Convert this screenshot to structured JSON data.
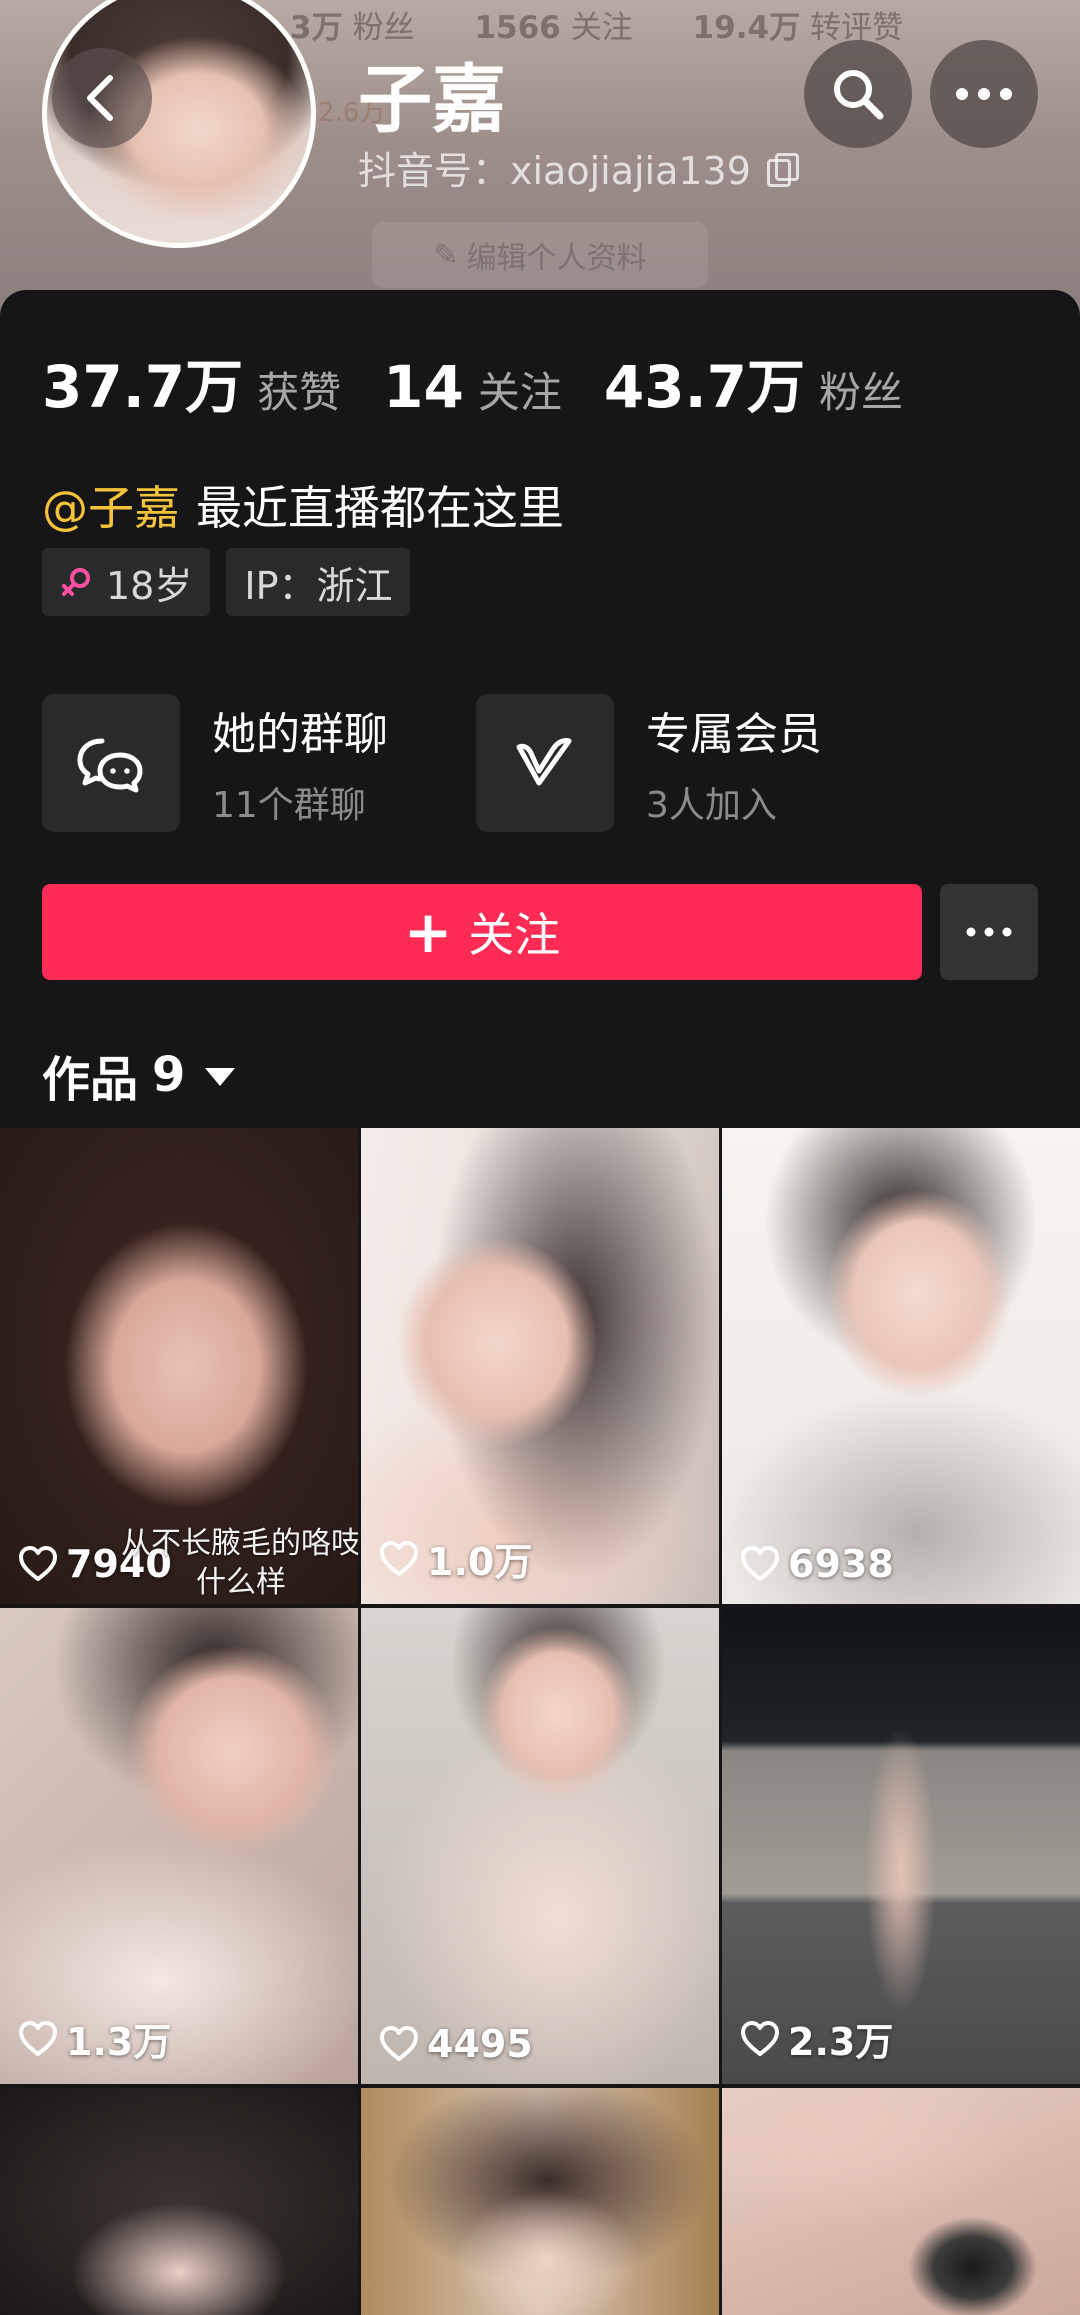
{
  "header_bg": {
    "ghost_stats": [
      {
        "num": "3万",
        "label": "粉丝"
      },
      {
        "num": "1566",
        "label": "关注"
      },
      {
        "num": "19.4万",
        "label": "转评赞"
      }
    ],
    "ghost_small": "2.6万",
    "ghost_edit": "编辑个人资料"
  },
  "profile": {
    "name": "子嘉",
    "douyin_id": "抖音号：xiaojiajia139"
  },
  "stats": [
    {
      "num": "37.7万",
      "label": "获赞"
    },
    {
      "num": "14",
      "label": "关注"
    },
    {
      "num": "43.7万",
      "label": "粉丝"
    }
  ],
  "bio": {
    "mention": "@子嘉",
    "text": "最近直播都在这里"
  },
  "tags": [
    {
      "icon": "female-icon",
      "text": "18岁"
    },
    {
      "text": "IP：浙江"
    }
  ],
  "features": [
    {
      "icon": "group-chat-icon",
      "title": "她的群聊",
      "sub": "11个群聊"
    },
    {
      "icon": "vip-v-icon",
      "title": "专属会员",
      "sub": "3人加入"
    }
  ],
  "follow": {
    "plus": "+",
    "label": "关注"
  },
  "works": {
    "label": "作品",
    "count": "9"
  },
  "tiles": [
    {
      "likes": "7940",
      "caption_1": "从不长腋毛的咯吱",
      "caption_2": "什么样"
    },
    {
      "likes": "1.0万"
    },
    {
      "likes": "6938"
    },
    {
      "likes": "1.3万"
    },
    {
      "likes": "4495"
    },
    {
      "likes": "2.3万"
    },
    {
      "likes": ""
    },
    {
      "likes": ""
    },
    {
      "likes": ""
    }
  ],
  "colors": {
    "accent": "#fe2c55",
    "mention": "#f5c33b",
    "female": "#ff4fa0",
    "background": "#161618"
  }
}
